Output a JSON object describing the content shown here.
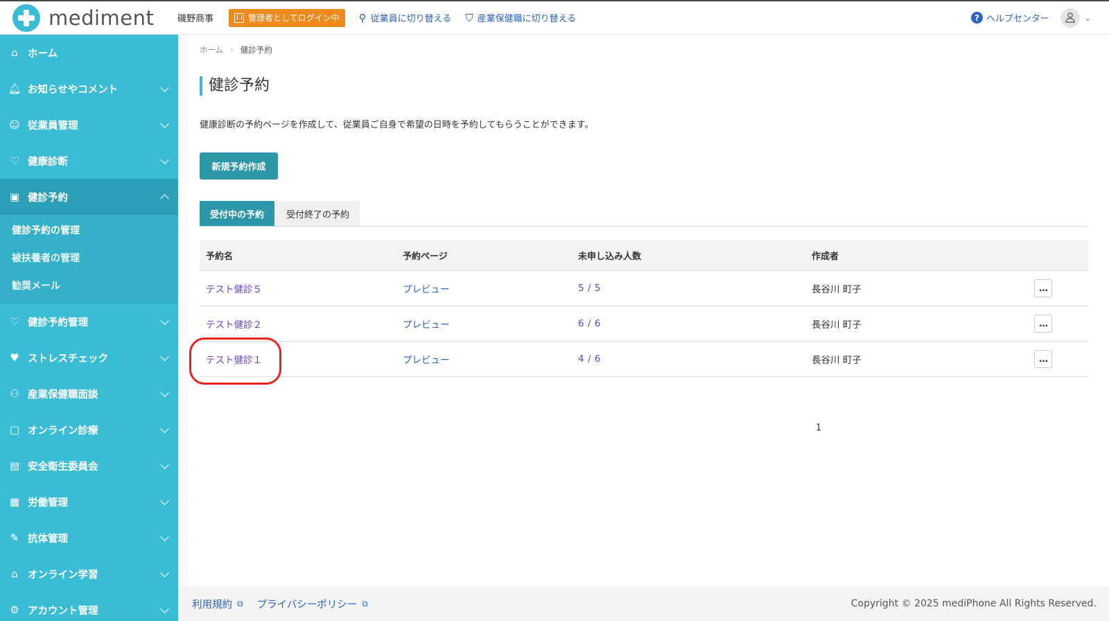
{
  "header": {
    "logo_text": "mediment",
    "company": "磯野商事",
    "admin_badge": "管理者としてログイン中",
    "switch_employee": "従業員に切り替える",
    "switch_staff": "産業保健職に切り替える",
    "help": "ヘルプセンター"
  },
  "sidebar": {
    "items": [
      {
        "label": "ホーム",
        "icon": "home-icon"
      },
      {
        "label": "お知らせやコメント",
        "icon": "bell-icon"
      },
      {
        "label": "従業員管理",
        "icon": "users-icon"
      },
      {
        "label": "健康診断",
        "icon": "stethoscope-icon"
      },
      {
        "label": "健診予約",
        "icon": "calendar-icon"
      },
      {
        "label": "健診予約管理",
        "icon": "stethoscope-icon"
      },
      {
        "label": "ストレスチェック",
        "icon": "heart-icon"
      },
      {
        "label": "産業保健職面談",
        "icon": "meeting-icon"
      },
      {
        "label": "オンライン診療",
        "icon": "video-icon"
      },
      {
        "label": "安全衛生委員会",
        "icon": "document-icon"
      },
      {
        "label": "労働管理",
        "icon": "calendar-icon"
      },
      {
        "label": "抗体管理",
        "icon": "syringe-icon"
      },
      {
        "label": "オンライン学習",
        "icon": "graduation-icon"
      },
      {
        "label": "アカウント管理",
        "icon": "gear-icon"
      }
    ],
    "sub_items": [
      "健診予約の管理",
      "被扶養者の管理",
      "勧奨メール"
    ]
  },
  "breadcrumb": {
    "home": "ホーム",
    "current": "健診予約"
  },
  "page": {
    "title": "健診予約",
    "description": "健康診断の予約ページを作成して、従業員ご自身で希望の日時を予約してもらうことができます。",
    "new_button": "新規予約作成"
  },
  "tabs": {
    "active": "受付中の予約",
    "closed": "受付終了の予約"
  },
  "table": {
    "headers": [
      "予約名",
      "予約ページ",
      "未申し込み人数",
      "作成者"
    ],
    "rows": [
      {
        "name": "テスト健診５",
        "page": "プレビュー",
        "count": "5 / 5",
        "author": "長谷川 町子"
      },
      {
        "name": "テスト健診２",
        "page": "プレビュー",
        "count": "6 / 6",
        "author": "長谷川 町子"
      },
      {
        "name": "テスト健診１",
        "page": "プレビュー",
        "count": "4 / 6",
        "author": "長谷川 町子"
      }
    ],
    "more": "…"
  },
  "pagination": {
    "page": "1"
  },
  "footer": {
    "terms": "利用規約",
    "privacy": "プライバシーポリシー",
    "copyright": "Copyright © 2025 mediPhone All Rights Reserved."
  }
}
